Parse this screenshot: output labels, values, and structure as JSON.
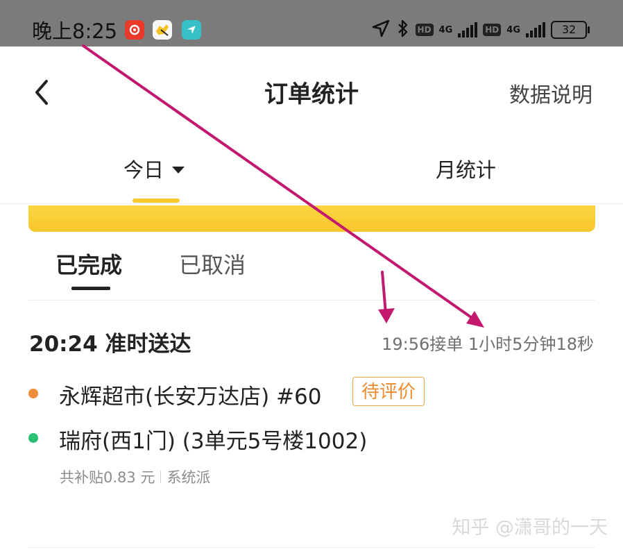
{
  "status_bar": {
    "time": "晚上8:25",
    "hd_badge": "HD",
    "network_label": "4G",
    "battery_level": "32",
    "icons": [
      "netease-music-icon",
      "meituan-app-icon",
      "location-app-icon",
      "gps-arrow-icon",
      "bluetooth-icon",
      "signal-icon",
      "battery-icon"
    ]
  },
  "header": {
    "title": "订单统计",
    "right_link": "数据说明",
    "back_icon": "chevron-left-icon"
  },
  "top_tabs": {
    "today_label": "今日",
    "month_label": "月统计",
    "active": "今日"
  },
  "sub_tabs": {
    "completed_label": "已完成",
    "cancelled_label": "已取消",
    "active": "已完成"
  },
  "order": {
    "delivered_time": "20:24",
    "delivery_status": "准时送达",
    "accepted_info": "19:56接单 1小时5分钟18秒",
    "pickup_name": "永辉超市(长安万达店) #60",
    "review_badge": "待评价",
    "delivery_address": "瑞府(西1门) (3单元5号楼1002)",
    "subsidy_text": "共补贴0.83 元",
    "dispatch_type": "系统派"
  },
  "watermark": "知乎 @潇哥的一天",
  "colors": {
    "accent_yellow": "#f8c929",
    "status_bar": "#7b7b7b",
    "pickup_dot": "#f08c3a",
    "delivery_dot": "#29c275",
    "badge_orange": "#ef8a2c",
    "annotation_arrow": "#c2186e"
  }
}
